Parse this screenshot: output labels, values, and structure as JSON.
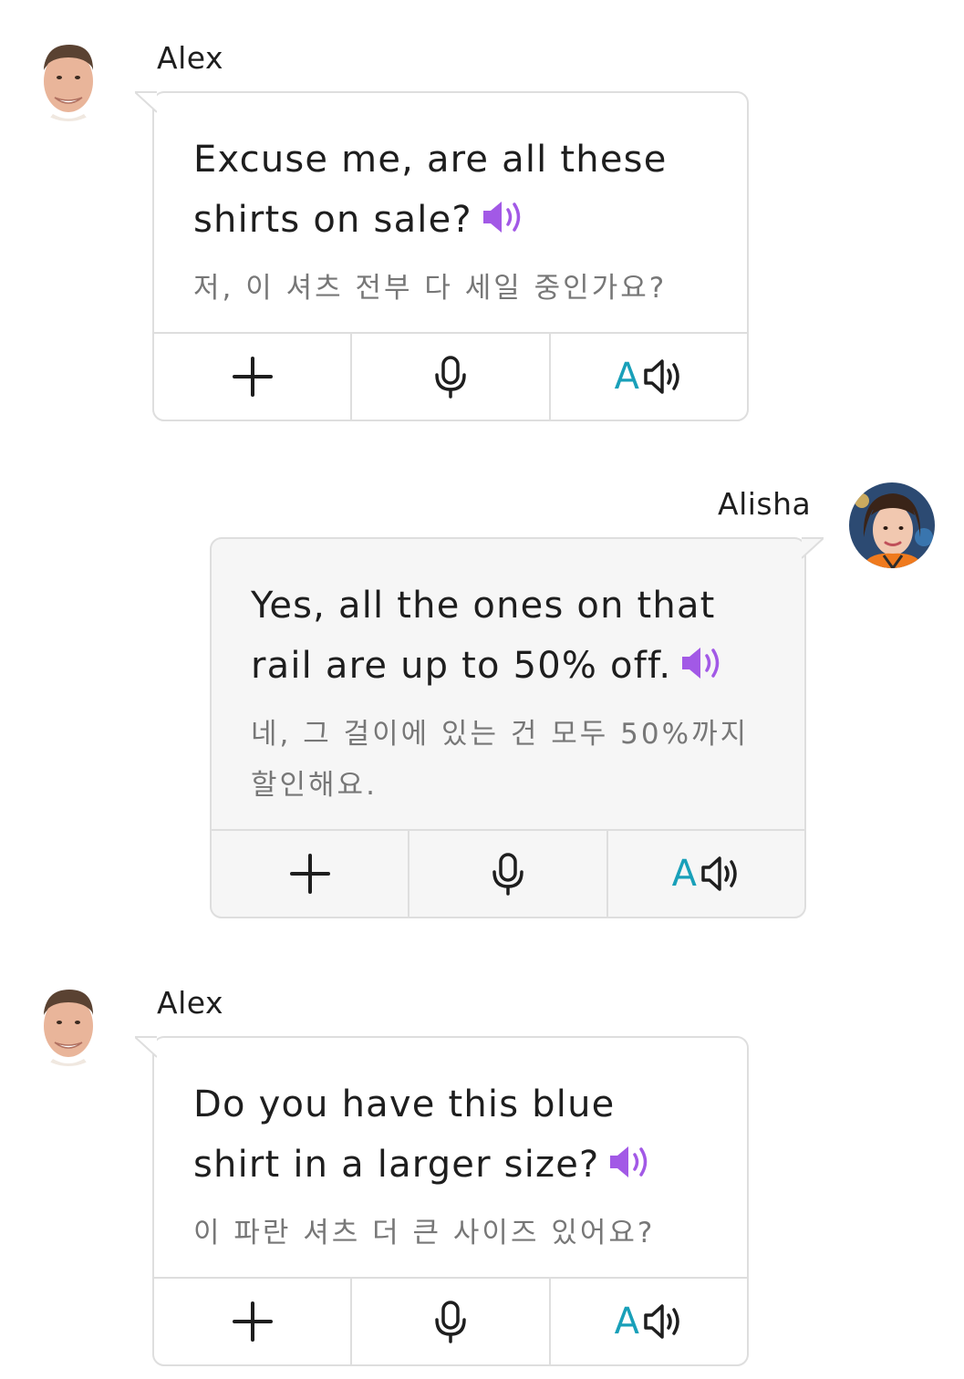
{
  "messages": [
    {
      "speaker": "Alex",
      "english": "Excuse me, are all these shirts on sale?",
      "korean": "저, 이 셔츠 전부 다 세일 중인가요?"
    },
    {
      "speaker": "Alisha",
      "english": "Yes, all the ones on that rail are up to 50% off.",
      "korean": "네, 그 걸이에 있는 건 모두 50%까지 할인해요."
    },
    {
      "speaker": "Alex",
      "english": "Do you have this blue shirt in a larger size?",
      "korean": "이 파란 셔츠 더 큰 사이즈 있어요?"
    }
  ],
  "toolbar": {
    "add_icon": "plus-icon",
    "record_icon": "microphone-icon",
    "tts_letter": "A",
    "tts_icon": "speaker-icon"
  },
  "colors": {
    "accent_purple": "#a259e6",
    "accent_teal": "#19a0b9",
    "border": "#dedede",
    "translation": "#777777"
  }
}
